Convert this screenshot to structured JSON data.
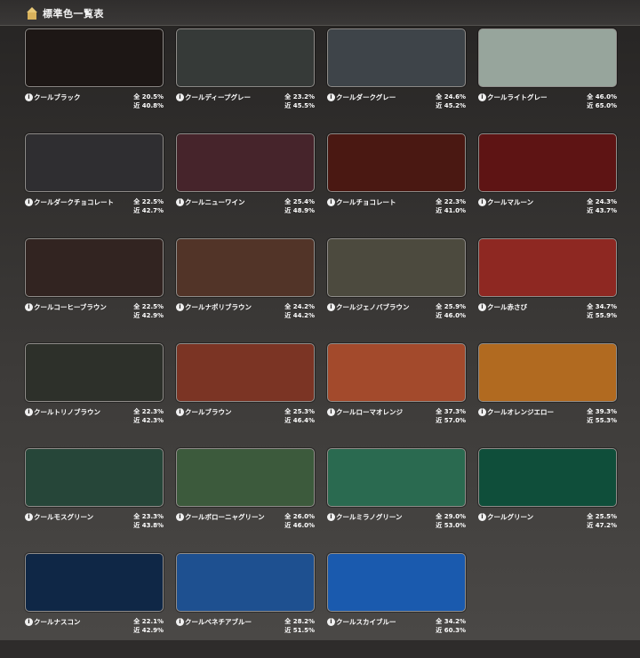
{
  "header": {
    "title": "標準色一覧表"
  },
  "labels": {
    "info": "i"
  },
  "colors": [
    {
      "name": "クールブラック",
      "total": "全 20.5%",
      "near": "近 40.8%",
      "hex": "#1d1715"
    },
    {
      "name": "クールディープグレー",
      "total": "全 23.2%",
      "near": "近 45.5%",
      "hex": "#363a38"
    },
    {
      "name": "クールダークグレー",
      "total": "全 24.6%",
      "near": "近 45.2%",
      "hex": "#3e4449"
    },
    {
      "name": "クールライトグレー",
      "total": "全 46.0%",
      "near": "近 65.0%",
      "hex": "#97a59c"
    },
    {
      "name": "クールダークチョコレート",
      "total": "全 22.5%",
      "near": "近 42.7%",
      "hex": "#2f2e31"
    },
    {
      "name": "クールニューワイン",
      "total": "全 25.4%",
      "near": "近 48.9%",
      "hex": "#46242b"
    },
    {
      "name": "クールチョコレート",
      "total": "全 22.3%",
      "near": "近 41.0%",
      "hex": "#4a1812"
    },
    {
      "name": "クールマルーン",
      "total": "全 24.3%",
      "near": "近 43.7%",
      "hex": "#5e1414"
    },
    {
      "name": "クールコーヒーブラウン",
      "total": "全 22.5%",
      "near": "近 42.9%",
      "hex": "#322421"
    },
    {
      "name": "クールナポリブラウン",
      "total": "全 24.2%",
      "near": "近 44.2%",
      "hex": "#523428"
    },
    {
      "name": "クールジェノバブラウン",
      "total": "全 25.9%",
      "near": "近 46.0%",
      "hex": "#4c4a3e"
    },
    {
      "name": "クール赤さび",
      "total": "全 34.7%",
      "near": "近 55.9%",
      "hex": "#8e2822"
    },
    {
      "name": "クールトリノブラウン",
      "total": "全 22.3%",
      "near": "近 42.3%",
      "hex": "#2d302a"
    },
    {
      "name": "クールブラウン",
      "total": "全 25.3%",
      "near": "近 46.4%",
      "hex": "#7b3424"
    },
    {
      "name": "クールローマオレンジ",
      "total": "全 37.3%",
      "near": "近 57.0%",
      "hex": "#a34a2c"
    },
    {
      "name": "クールオレンジエロー",
      "total": "全 39.3%",
      "near": "近 55.3%",
      "hex": "#b16a20"
    },
    {
      "name": "クールモスグリーン",
      "total": "全 23.3%",
      "near": "近 43.8%",
      "hex": "#264639"
    },
    {
      "name": "クールボローニャグリーン",
      "total": "全 26.0%",
      "near": "近 46.0%",
      "hex": "#3c5a3c"
    },
    {
      "name": "クールミラノグリーン",
      "total": "全 29.0%",
      "near": "近 53.0%",
      "hex": "#2a6a50"
    },
    {
      "name": "クールグリーン",
      "total": "全 25.5%",
      "near": "近 47.2%",
      "hex": "#0f4e3a"
    },
    {
      "name": "クールナスコン",
      "total": "全 22.1%",
      "near": "近 42.9%",
      "hex": "#0f2746"
    },
    {
      "name": "クールベネチアブルー",
      "total": "全 28.2%",
      "near": "近 51.5%",
      "hex": "#1e5090"
    },
    {
      "name": "クールスカイブルー",
      "total": "全 34.2%",
      "near": "近 60.3%",
      "hex": "#1a5aae"
    }
  ]
}
